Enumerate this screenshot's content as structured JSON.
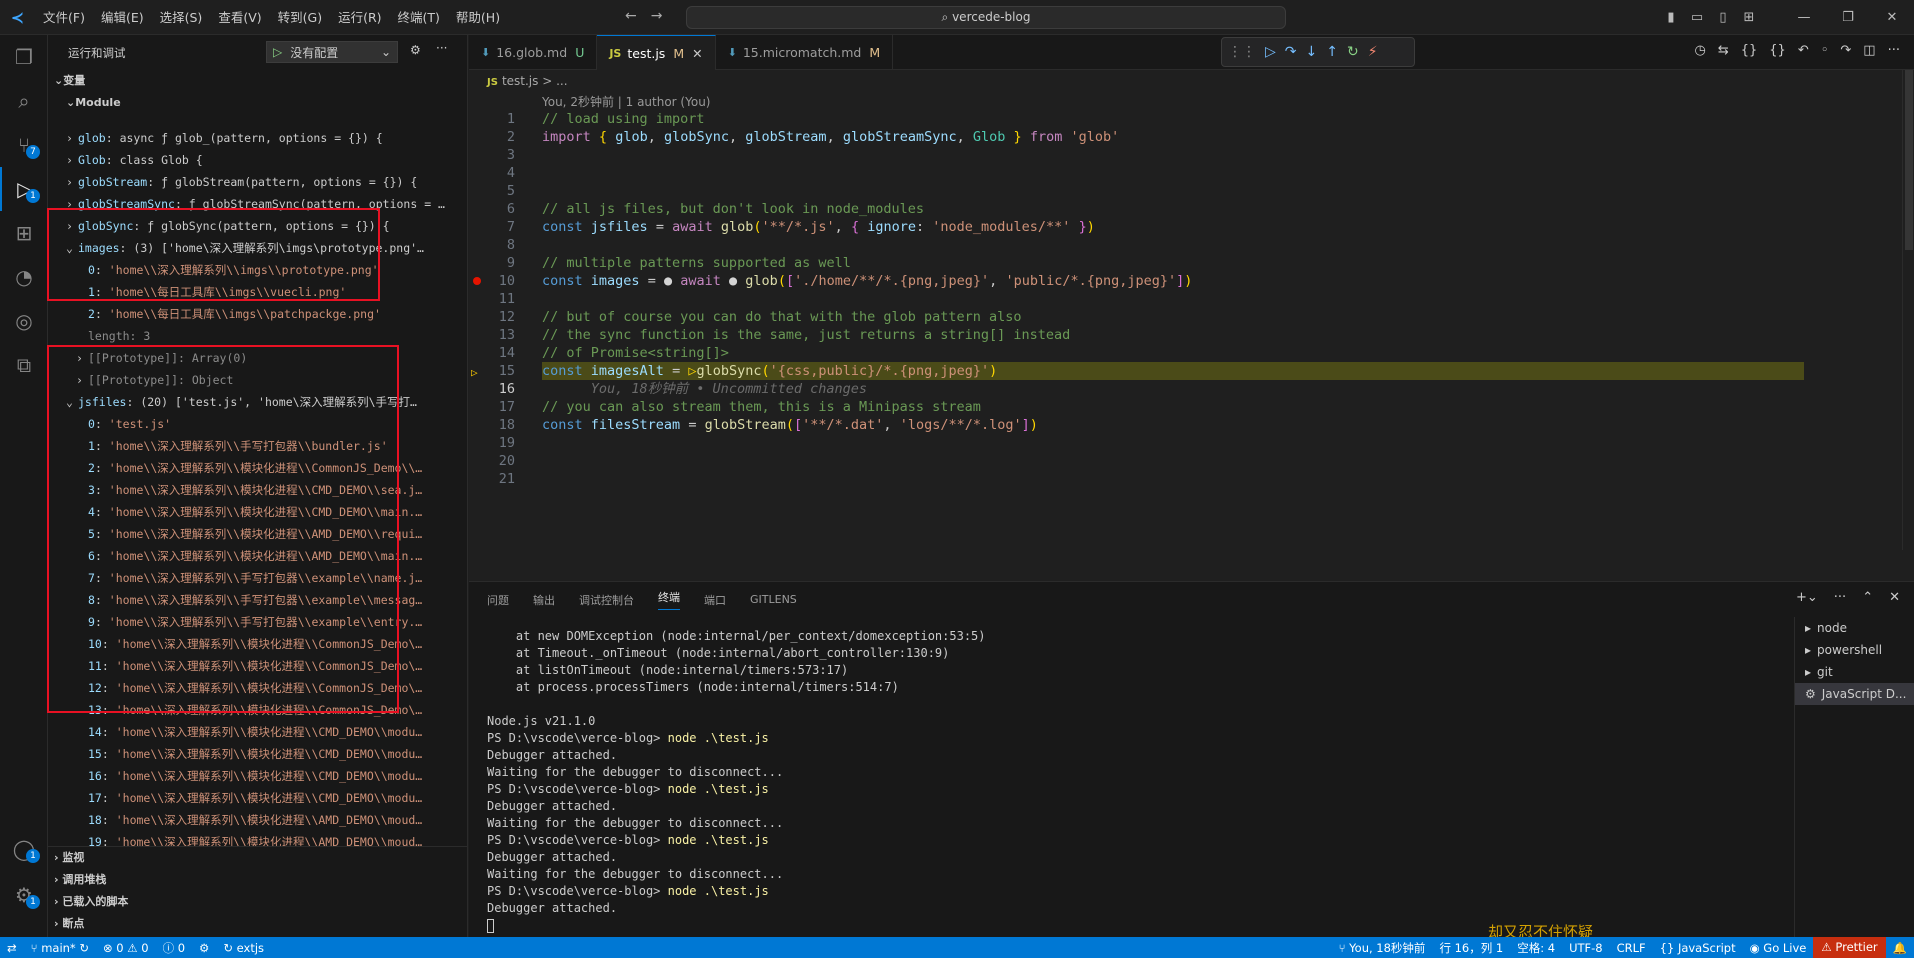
{
  "menu": [
    "文件(F)",
    "编辑(E)",
    "选择(S)",
    "查看(V)",
    "转到(G)",
    "运行(R)",
    "终端(T)",
    "帮助(H)"
  ],
  "search": {
    "text": "vercede-blog"
  },
  "sidebar": {
    "title": "运行和调试",
    "config_label": "没有配置",
    "variables_title": "变量",
    "module_label": "Module",
    "module_items": [
      {
        "key": "glob",
        "val": "async ƒ glob_(pattern, options = {}) {"
      },
      {
        "key": "Glob",
        "val": "class Glob {"
      },
      {
        "key": "globStream",
        "val": "ƒ globStream(pattern, options = {}) {"
      },
      {
        "key": "globStreamSync",
        "val": "ƒ globStreamSync(pattern, options = …"
      },
      {
        "key": "globSync",
        "val": "ƒ globSync(pattern, options = {}) {"
      }
    ],
    "images_label": "images",
    "images_summary": "(3) ['home\\深入理解系列\\imgs\\prototype.png'…",
    "images_items": [
      {
        "idx": "0",
        "val": "'home\\\\深入理解系列\\\\imgs\\\\prototype.png'"
      },
      {
        "idx": "1",
        "val": "'home\\\\每日工具库\\\\imgs\\\\vuecli.png'"
      },
      {
        "idx": "2",
        "val": "'home\\\\每日工具库\\\\imgs\\\\patchpackge.png'"
      }
    ],
    "images_length": "length: 3",
    "proto_array": "[[Prototype]]: Array(0)",
    "proto_object": "[[Prototype]]: Object",
    "jsfiles_label": "jsfiles",
    "jsfiles_summary": "(20) ['test.js', 'home\\深入理解系列\\手写打…",
    "jsfiles_items": [
      {
        "idx": "0",
        "val": "'test.js'"
      },
      {
        "idx": "1",
        "val": "'home\\\\深入理解系列\\\\手写打包器\\\\bundler.js'"
      },
      {
        "idx": "2",
        "val": "'home\\\\深入理解系列\\\\模块化进程\\\\CommonJS_Demo\\\\…"
      },
      {
        "idx": "3",
        "val": "'home\\\\深入理解系列\\\\模块化进程\\\\CMD_DEMO\\\\sea.j…"
      },
      {
        "idx": "4",
        "val": "'home\\\\深入理解系列\\\\模块化进程\\\\CMD_DEMO\\\\main.…"
      },
      {
        "idx": "5",
        "val": "'home\\\\深入理解系列\\\\模块化进程\\\\AMD_DEMO\\\\requi…"
      },
      {
        "idx": "6",
        "val": "'home\\\\深入理解系列\\\\模块化进程\\\\AMD_DEMO\\\\main.…"
      },
      {
        "idx": "7",
        "val": "'home\\\\深入理解系列\\\\手写打包器\\\\example\\\\name.j…"
      },
      {
        "idx": "8",
        "val": "'home\\\\深入理解系列\\\\手写打包器\\\\example\\\\messag…"
      },
      {
        "idx": "9",
        "val": "'home\\\\深入理解系列\\\\手写打包器\\\\example\\\\entry.…"
      },
      {
        "idx": "10",
        "val": "'home\\\\深入理解系列\\\\模块化进程\\\\CommonJS_Demo\\…"
      },
      {
        "idx": "11",
        "val": "'home\\\\深入理解系列\\\\模块化进程\\\\CommonJS_Demo\\…"
      },
      {
        "idx": "12",
        "val": "'home\\\\深入理解系列\\\\模块化进程\\\\CommonJS_Demo\\…"
      },
      {
        "idx": "13",
        "val": "'home\\\\深入理解系列\\\\模块化进程\\\\CommonJS_Demo\\…"
      },
      {
        "idx": "14",
        "val": "'home\\\\深入理解系列\\\\模块化进程\\\\CMD_DEMO\\\\modu…"
      },
      {
        "idx": "15",
        "val": "'home\\\\深入理解系列\\\\模块化进程\\\\CMD_DEMO\\\\modu…"
      },
      {
        "idx": "16",
        "val": "'home\\\\深入理解系列\\\\模块化进程\\\\CMD_DEMO\\\\modu…"
      },
      {
        "idx": "17",
        "val": "'home\\\\深入理解系列\\\\模块化进程\\\\CMD_DEMO\\\\modu…"
      },
      {
        "idx": "18",
        "val": "'home\\\\深入理解系列\\\\模块化进程\\\\AMD_DEMO\\\\moud…"
      },
      {
        "idx": "19",
        "val": "'home\\\\深入理解系列\\\\模块化进程\\\\AMD_DEMO\\\\moud…"
      }
    ],
    "watch": "监视",
    "callstack": "调用堆栈",
    "loaded_scripts": "已载入的脚本",
    "breakpoints": "断点"
  },
  "tabs": [
    {
      "name": "16.glob.md",
      "status": "U"
    },
    {
      "name": "test.js",
      "status": "M"
    },
    {
      "name": "15.micromatch.md",
      "status": "M"
    }
  ],
  "breadcrumb": {
    "file": "test.js",
    "rest": "> ..."
  },
  "blame": "You, 2秒钟前 | 1 author (You)",
  "code_lines": [
    {
      "n": "1",
      "html": "<span class=\"c-cm\">// load using import</span>"
    },
    {
      "n": "2",
      "html": "<span class=\"c-kw2\">import</span> <span class=\"c-br\">{</span> <span class=\"c-id\">glob</span>, <span class=\"c-id\">globSync</span>, <span class=\"c-id\">globStream</span>, <span class=\"c-id\">globStreamSync</span>, <span class=\"c-cls\">Glob</span> <span class=\"c-br\">}</span> <span class=\"c-kw2\">from</span> <span class=\"c-str\">'glob'</span>"
    },
    {
      "n": "3",
      "html": ""
    },
    {
      "n": "4",
      "html": ""
    },
    {
      "n": "5",
      "html": ""
    },
    {
      "n": "6",
      "html": "<span class=\"c-cm\">// all js files, but don't look in node_modules</span>"
    },
    {
      "n": "7",
      "html": "<span class=\"c-kw\">const</span> <span class=\"c-id\">jsfiles</span> = <span class=\"c-kw2\">await</span> <span class=\"c-fn\">glob</span><span class=\"c-br\">(</span><span class=\"c-str\">'**/*.js'</span>, <span class=\"c-br2\">{</span> <span class=\"c-id\">ignore</span>: <span class=\"c-str\">'node_modules/**'</span> <span class=\"c-br2\">}</span><span class=\"c-br\">)</span>"
    },
    {
      "n": "8",
      "html": ""
    },
    {
      "n": "9",
      "html": "<span class=\"c-cm\">// multiple patterns supported as well</span>"
    },
    {
      "n": "10",
      "html": "<span class=\"c-kw\">const</span> <span class=\"c-id\">images</span> = <span class=\"c-pl\">●</span> <span class=\"c-kw2\">await</span> <span class=\"c-pl\">●</span> <span class=\"c-fn\">glob</span><span class=\"c-br\">(</span><span class=\"c-br2\">[</span><span class=\"c-str\">'./home/**/*.{png,jpeg}'</span>, <span class=\"c-str\">'public/*.{png,jpeg}'</span><span class=\"c-br2\">]</span><span class=\"c-br\">)</span>"
    },
    {
      "n": "11",
      "html": ""
    },
    {
      "n": "12",
      "html": "<span class=\"c-cm\">// but of course you can do that with the glob pattern also</span>"
    },
    {
      "n": "13",
      "html": "<span class=\"c-cm\">// the sync function is the same, just returns a string[] instead</span>"
    },
    {
      "n": "14",
      "html": "<span class=\"c-cm\">// of Promise&lt;string[]&gt;</span>"
    },
    {
      "n": "15",
      "html": "<span class=\"c-kw\">const</span> <span class=\"c-id\">imagesAlt</span> = <span class=\"c-br\">▷</span><span class=\"c-fn\">globSync</span><span class=\"c-br\">(</span><span class=\"c-str\">'{css,public}/*.{png,jpeg}'</span><span class=\"c-br\">)</span>"
    },
    {
      "n": "16",
      "html": "      <span class=\"c-gh\">You, 18秒钟前 • Uncommitted changes</span>"
    },
    {
      "n": "17",
      "html": "<span class=\"c-cm\">// you can also stream them, this is a Minipass stream</span>"
    },
    {
      "n": "18",
      "html": "<span class=\"c-kw\">const</span> <span class=\"c-id\">filesStream</span> = <span class=\"c-fn\">globStream</span><span class=\"c-br\">(</span><span class=\"c-br2\">[</span><span class=\"c-str\">'**/*.dat'</span>, <span class=\"c-str\">'logs/**/*.log'</span><span class=\"c-br2\">]</span><span class=\"c-br\">)</span>"
    },
    {
      "n": "19",
      "html": ""
    },
    {
      "n": "20",
      "html": ""
    },
    {
      "n": "21",
      "html": ""
    }
  ],
  "panel_tabs": [
    "问题",
    "输出",
    "调试控制台",
    "终端",
    "端口",
    "GITLENS"
  ],
  "terminal_lines": [
    {
      "t": "    at new DOMException (node:internal/per_context/domexception:53:5)",
      "c": ""
    },
    {
      "t": "    at Timeout._onTimeout (node:internal/abort_controller:130:9)",
      "c": ""
    },
    {
      "t": "    at listOnTimeout (node:internal/timers:573:17)",
      "c": ""
    },
    {
      "t": "    at process.processTimers (node:internal/timers:514:7)",
      "c": ""
    },
    {
      "t": "",
      "c": ""
    },
    {
      "t": "Node.js v21.1.0",
      "c": ""
    },
    {
      "t": "PS D:\\vscode\\verce-blog> ",
      "c": "node .\\test.js"
    },
    {
      "t": "Debugger attached.",
      "c": ""
    },
    {
      "t": "Waiting for the debugger to disconnect...",
      "c": ""
    },
    {
      "t": "PS D:\\vscode\\verce-blog> ",
      "c": "node .\\test.js"
    },
    {
      "t": "Debugger attached.",
      "c": ""
    },
    {
      "t": "Waiting for the debugger to disconnect...",
      "c": ""
    },
    {
      "t": "PS D:\\vscode\\verce-blog> ",
      "c": "node .\\test.js"
    },
    {
      "t": "Debugger attached.",
      "c": ""
    },
    {
      "t": "Waiting for the debugger to disconnect...",
      "c": ""
    },
    {
      "t": "PS D:\\vscode\\verce-blog> ",
      "c": "node .\\test.js"
    },
    {
      "t": "Debugger attached.",
      "c": ""
    }
  ],
  "terminal_list": [
    "node",
    "powershell",
    "git",
    "JavaScript D..."
  ],
  "watermark": "却又忍不住怀疑",
  "statusbar": {
    "branch": "main*",
    "errors": "0",
    "warnings": "0",
    "info": "0",
    "extjs": "extjs",
    "blame": "You, 18秒钟前",
    "position": "行 16，列 1",
    "spaces": "空格: 4",
    "encoding": "UTF-8",
    "eol": "CRLF",
    "language": "JavaScript",
    "golive": "Go Live",
    "prettier": "Prettier"
  }
}
